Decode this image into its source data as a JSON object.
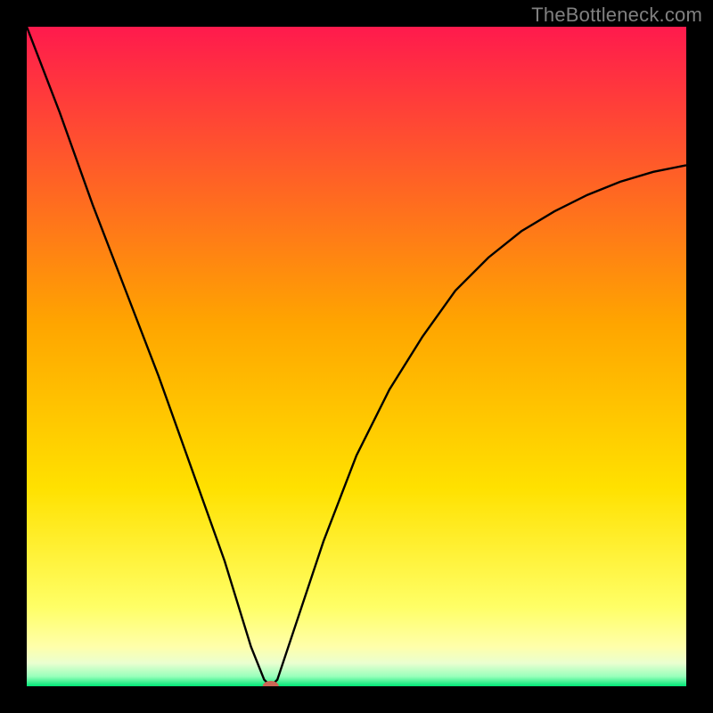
{
  "watermark": "TheBottleneck.com",
  "chart_data": {
    "type": "line",
    "title": "",
    "xlabel": "",
    "ylabel": "",
    "xlim": [
      0,
      100
    ],
    "ylim": [
      0,
      100
    ],
    "grid": false,
    "background_gradient": {
      "stops": [
        {
          "offset": 0.0,
          "color": "#ff1a4d"
        },
        {
          "offset": 0.45,
          "color": "#ffa500"
        },
        {
          "offset": 0.7,
          "color": "#ffe100"
        },
        {
          "offset": 0.88,
          "color": "#ffff66"
        },
        {
          "offset": 0.94,
          "color": "#ffffaa"
        },
        {
          "offset": 0.965,
          "color": "#eaffd0"
        },
        {
          "offset": 0.985,
          "color": "#99ffbb"
        },
        {
          "offset": 1.0,
          "color": "#00e676"
        }
      ]
    },
    "series": [
      {
        "name": "bottleneck-curve",
        "color": "#000000",
        "x": [
          0,
          5,
          10,
          15,
          20,
          25,
          30,
          34,
          36,
          37,
          38,
          40,
          45,
          50,
          55,
          60,
          65,
          70,
          75,
          80,
          85,
          90,
          95,
          100
        ],
        "y": [
          100,
          87,
          73,
          60,
          47,
          33,
          19,
          6,
          1,
          0,
          1,
          7,
          22,
          35,
          45,
          53,
          60,
          65,
          69,
          72,
          74.5,
          76.5,
          78,
          79
        ]
      }
    ],
    "marker": {
      "name": "optimal-marker",
      "x": 37,
      "y": 0,
      "color": "#cc6655",
      "rx": 9,
      "ry": 6
    }
  }
}
